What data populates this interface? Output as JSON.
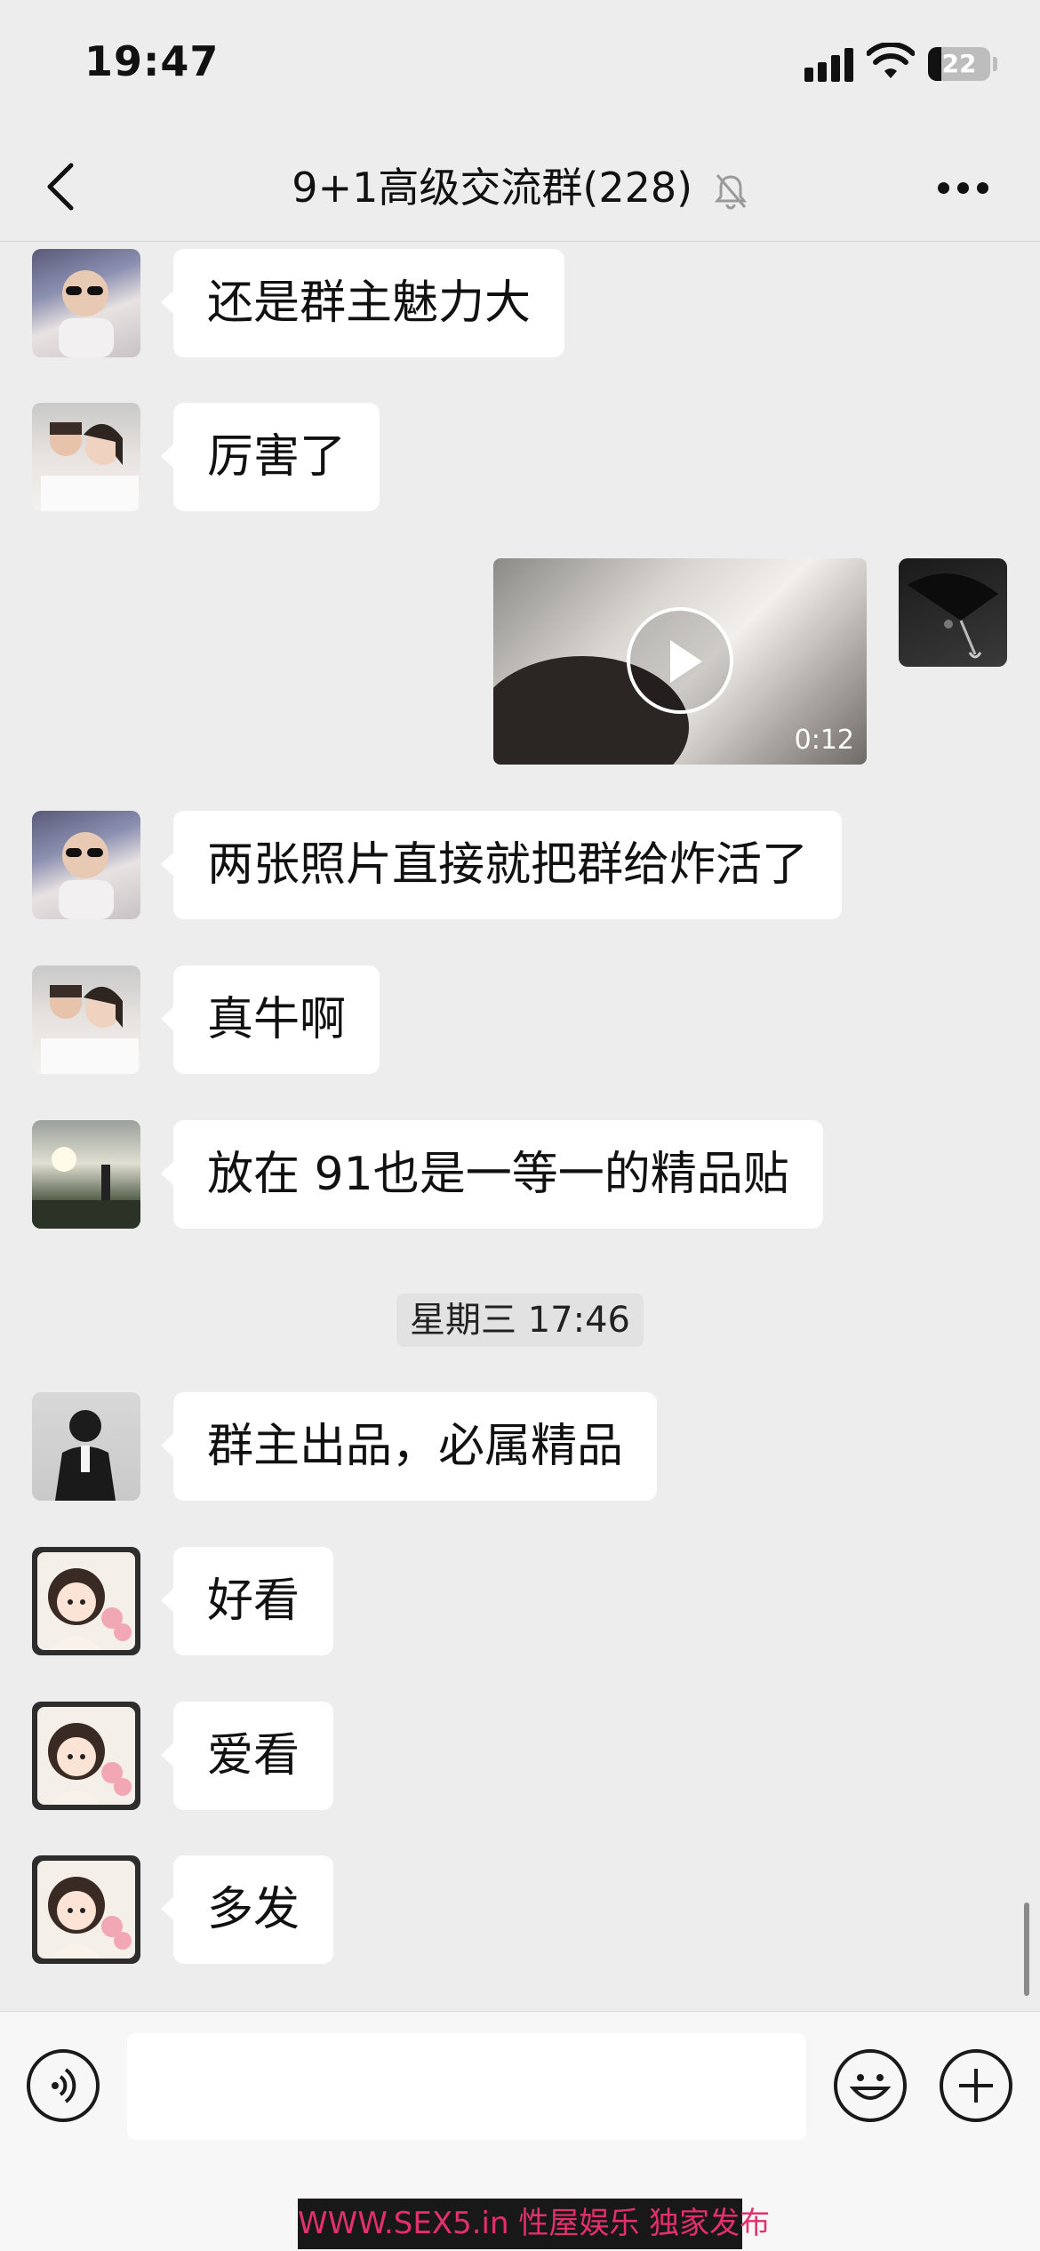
{
  "status_bar": {
    "time": "19:47",
    "battery": "22"
  },
  "nav": {
    "title": "9+1高级交流群(228)"
  },
  "messages": [
    {
      "text": "还是群主魅力大"
    },
    {
      "text": "厉害了"
    },
    {
      "text": "两张照片直接就把群给炸活了"
    },
    {
      "text": "真牛啊"
    },
    {
      "text": "放在 91也是一等一的精品贴"
    },
    {
      "text": "群主出品，必属精品"
    },
    {
      "text": "好看"
    },
    {
      "text": "爱看"
    },
    {
      "text": "多发"
    }
  ],
  "video_message": {
    "duration": "0:12"
  },
  "time_separator": "星期三 17:46",
  "watermark": "WWW.SEX5.in 性屋娱乐 独家发布",
  "colors": {
    "background": "#ededed",
    "bubble": "#ffffff",
    "text": "#111111"
  }
}
